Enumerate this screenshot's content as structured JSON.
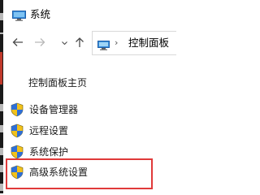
{
  "window": {
    "title": "系统",
    "title_icon": "computer-icon"
  },
  "nav": {
    "back_icon": "arrow-left-icon",
    "forward_icon": "arrow-right-icon",
    "recent_icon": "chevron-down-icon",
    "up_icon": "arrow-up-icon",
    "address": {
      "icon": "control-panel-icon",
      "separator": "›",
      "path": "控制面板"
    }
  },
  "left_panel": {
    "home_link": "控制面板主页",
    "tasks": [
      {
        "label": "设备管理器",
        "icon": "shield-icon"
      },
      {
        "label": "远程设置",
        "icon": "shield-icon"
      },
      {
        "label": "系统保护",
        "icon": "shield-icon"
      },
      {
        "label": "高级系统设置",
        "icon": "shield-icon"
      }
    ]
  },
  "annotation": {
    "highlight_color": "#e03a3a"
  },
  "colors": {
    "shield_blue": "#2f6fd6",
    "shield_yellow": "#f2c21b",
    "monitor_blue": "#3a8fdc"
  }
}
